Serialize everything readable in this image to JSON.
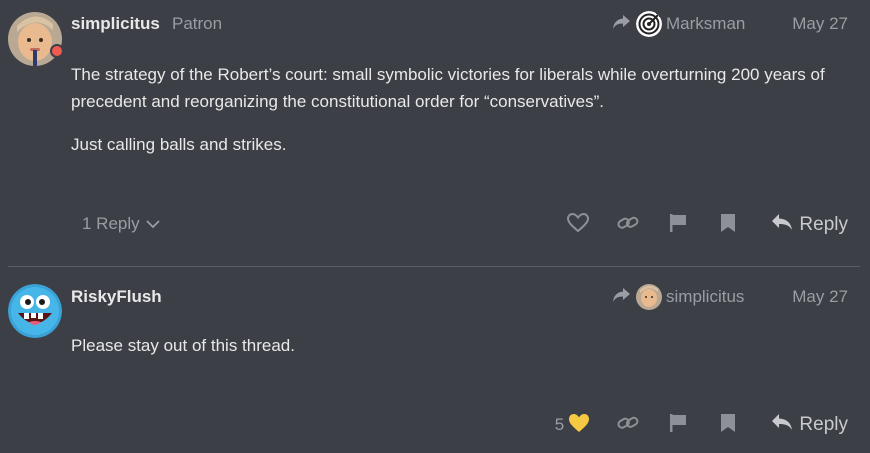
{
  "posts": [
    {
      "username": "simplicitus",
      "title": "Patron",
      "reply_to": {
        "name": "Marksman",
        "avatar_icon": "target-icon"
      },
      "date": "May 27",
      "paragraphs": [
        "The strategy of the Robert’s court: small symbolic victories for liberals while overturning 200 years of precedent and reorganizing the constitutional order for “conservatives”.",
        "Just calling balls and strikes."
      ],
      "replies_label": "1 Reply",
      "reply_label": "Reply"
    },
    {
      "username": "RiskyFlush",
      "reply_to": {
        "name": "simplicitus",
        "avatar_icon": "user-avatar-icon"
      },
      "date": "May 27",
      "paragraphs": [
        "Please stay out of this thread."
      ],
      "like_count": "5",
      "reply_label": "Reply"
    }
  ],
  "colors": {
    "background": "#3c3f45",
    "muted": "#9a9da3",
    "heart_liked": "#f6c942",
    "status_dot": "#f05a4f"
  }
}
